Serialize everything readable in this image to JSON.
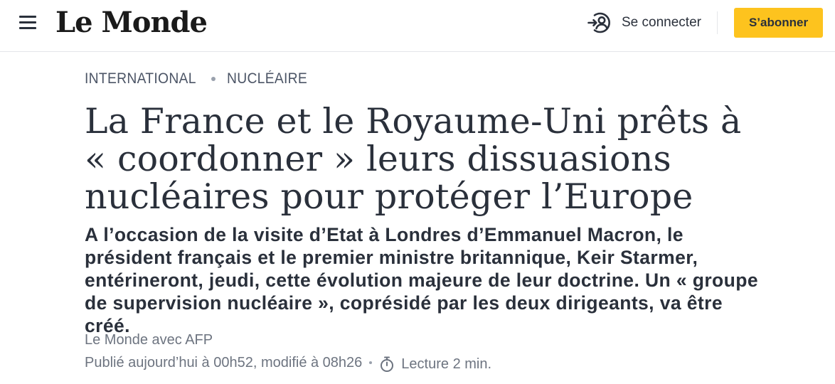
{
  "header": {
    "logo": "Le Monde",
    "login_label": "Se connecter",
    "subscribe_label": "S’abonner",
    "accent_color": "#fdc31e"
  },
  "breadcrumb": [
    "INTERNATIONAL",
    "NUCLÉAIRE"
  ],
  "article": {
    "headline": "La France et le Royaume-Uni prêts à « coordonner » leurs dissuasions nucléaires pour protéger l’Europe",
    "standfirst": "A l’occasion de la visite d’Etat à Londres d’Emmanuel Macron, le président français et le premier ministre britannique, Keir Starmer, entérineront, jeudi, cette évolution majeure de leur doctrine. Un « groupe de supervision nucléaire », coprésidé par les deux dirigeants, va être créé.",
    "author": "Le Monde avec AFP",
    "published": "Publié aujourd’hui à 00h52, modifié à 08h26",
    "reading_time": "Lecture 2 min."
  },
  "icons": {
    "menu": "hamburger-menu-icon",
    "login": "user-circle-login-icon",
    "reading": "stopwatch-icon"
  }
}
